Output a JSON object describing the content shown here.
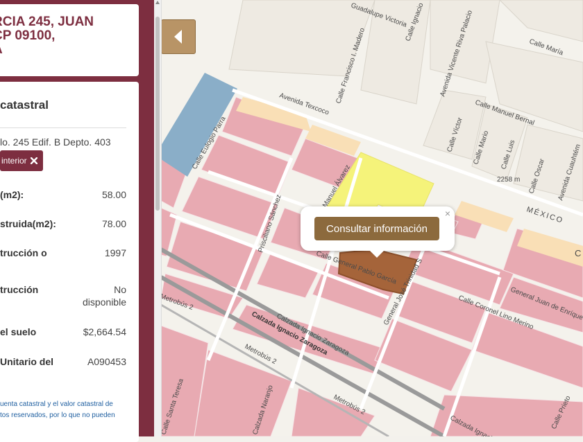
{
  "address_card": {
    "text": "RCIA 245, JUAN\nCP 09100,\nA"
  },
  "detail": {
    "title": "catastral",
    "address": "lo. 245 Edif. B Depto. 403",
    "interior_label": "interior",
    "rows": [
      {
        "label": "(m2):",
        "value": "58.00"
      },
      {
        "label": "struida(m2):",
        "value": "78.00"
      },
      {
        "label": "trucción o",
        "value": "1997"
      },
      {
        "label": "trucción",
        "value": "No\ndisponible"
      },
      {
        "label": "el suelo",
        "value": "$2,664.54"
      },
      {
        "label": "Unitario del",
        "value": "A090453"
      }
    ],
    "disclaimer": "uenta catastral y el valor catastral de\ntos reservados, por lo que no pueden"
  },
  "map": {
    "popup_button": "Consultar información",
    "popup_close": "×",
    "labels": {
      "guadalupe_victoria": "Guadalupe Victoria",
      "calle_ignacio": "Calle Ignacio",
      "calle_maria": "Calle María",
      "calle_francisco_madero": "Calle Francisco I. Madero",
      "avenida_vicente_riva_palacio": "Avenida Vicente Riva Palacio",
      "avenida_texcoco": "Avenida Texcoco",
      "calle_manuel_bernal": "Calle Manuel Bernal",
      "calle_victor": "Calle Víctor",
      "calle_mario": "Calle Mario",
      "calle_luis": "Calle Luis",
      "calle_oscar": "Calle Oscar",
      "avenida_cuauhtemoc": "Avenida Cuauhtém",
      "calle_eulogio_parra": "Calle Eulogio Parra",
      "manuel_alvarez": "Manuel Álvarez",
      "priscilano_sanchez": "Prisciliano Sánchez",
      "distance": "2258 m",
      "mexico": "MÉXICO",
      "calle_general_pablo_garcia": "Calle General Pablo García",
      "general_jose_trinidad": "General José Trinidad S",
      "calle_coronel_lino_merino": "Calle Coronel Lino Merino",
      "general_juan_de_enriquez": "General Juan de Enríque",
      "metrobus_2a": "Metrobús 2",
      "calzada_ignacio_zaragoza": "Calzada Ignacio Zaragoza",
      "calzada_ignacio_zaragoza_b": "Calzada Ignacio Zaragoza",
      "metrobus_2b": "Metrobús 2",
      "metrobus_2c": "Metrobús 2",
      "calzada_ignacio_zaragoza_c": "Calzada Ignacio Zaragoza",
      "calle_santa_teresa": "Calle Santa Teresa",
      "calzada_naranjo": "Calzada Naranjo",
      "calle_prieto": "Calle Prieto",
      "distrito": "C"
    }
  },
  "colors": {
    "panel": "#7d2e40",
    "accent_brown": "#8c6a3d",
    "parcel_pink": "#e8aab2",
    "selected_parcel": "#a5643a",
    "yellow_zone": "#f5f37a",
    "blue_zone": "#8aaec8",
    "beige_zone": "#f9dfb6"
  },
  "icons": {
    "collapse": "chevron-left-icon",
    "remove": "x-icon"
  }
}
